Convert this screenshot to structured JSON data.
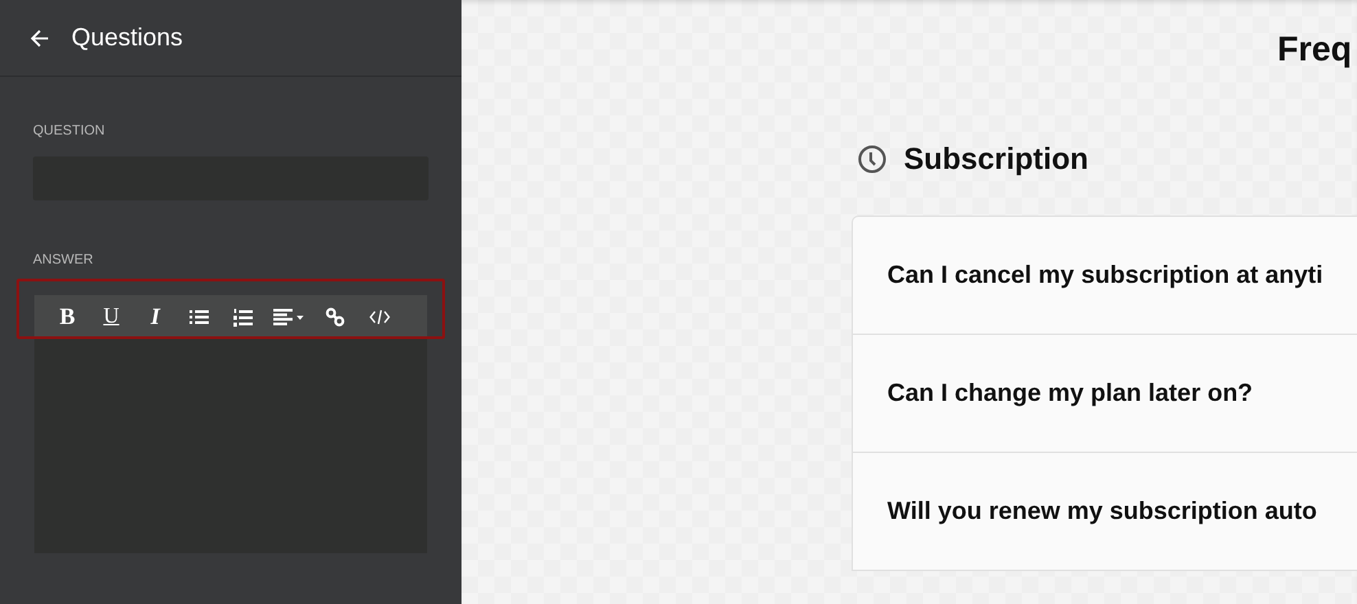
{
  "sidebar": {
    "title": "Questions",
    "question": {
      "label": "QUESTION"
    },
    "answer": {
      "label": "ANSWER",
      "highlighted": true,
      "toolbar": [
        {
          "kind": "bold",
          "label": "B"
        },
        {
          "kind": "underline",
          "label": "U"
        },
        {
          "kind": "italic",
          "label": "I"
        },
        {
          "kind": "bullet-list"
        },
        {
          "kind": "numbered-list"
        },
        {
          "kind": "align"
        },
        {
          "kind": "link"
        },
        {
          "kind": "code"
        }
      ]
    }
  },
  "main": {
    "title": "Freq",
    "section": {
      "title": "Subscription",
      "questions": [
        "Can I cancel my subscription at anyti",
        "Can I change my plan later on?",
        "Will you renew my subscription auto"
      ]
    }
  }
}
